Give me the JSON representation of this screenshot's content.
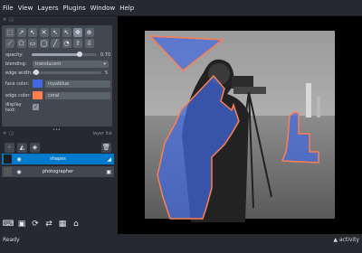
{
  "menu": [
    {
      "label": "File",
      "key": "F"
    },
    {
      "label": "View",
      "key": "V"
    },
    {
      "label": "Layers",
      "key": "L"
    },
    {
      "label": "Plugins",
      "key": "P"
    },
    {
      "label": "Window",
      "key": "W"
    },
    {
      "label": "Help",
      "key": "H"
    }
  ],
  "layer_controls": {
    "tools": [
      {
        "icon": "vertex-insert-icon",
        "glyph": "⬚"
      },
      {
        "icon": "vertex-remove-icon",
        "glyph": "↗"
      },
      {
        "icon": "select-vertices-icon",
        "glyph": "↖"
      },
      {
        "icon": "delete-shape-icon",
        "glyph": "✕"
      },
      {
        "icon": "select-shapes-icon",
        "glyph": "↖"
      },
      {
        "icon": "direct-select-icon",
        "glyph": "↖"
      },
      {
        "icon": "pan-zoom-icon",
        "glyph": "✥"
      },
      {
        "icon": "transform-icon",
        "glyph": "⊕"
      },
      {
        "icon": "path-icon",
        "glyph": "⟋"
      },
      {
        "icon": "polygon-icon",
        "glyph": "⬠"
      },
      {
        "icon": "rectangle-icon",
        "glyph": "▭"
      },
      {
        "icon": "ellipse-icon",
        "glyph": "◯"
      },
      {
        "icon": "line-icon",
        "glyph": "╱"
      },
      {
        "icon": "lasso-icon",
        "glyph": "◔"
      },
      {
        "icon": "move-front-icon",
        "glyph": "⇧"
      },
      {
        "icon": "move-back-icon",
        "glyph": "⇩"
      }
    ],
    "opacity_label": "opacity:",
    "opacity_value": "0.70",
    "opacity_fraction": 0.7,
    "blending_label": "blending:",
    "blending_value": "translucent",
    "edge_width_label": "edge width:",
    "edge_width_value": "5",
    "edge_width_fraction": 0.05,
    "face_color_label": "face color:",
    "face_color_value": "royalblue",
    "face_color_hex": "#4169e1",
    "edge_color_label": "edge color:",
    "edge_color_value": "coral",
    "edge_color_hex": "#ff7f50",
    "display_text_label": "display text:",
    "display_text_checked": true
  },
  "layers_title": "layer list",
  "layers": [
    {
      "name": "shapes",
      "selected": true,
      "type_icon": "shapes-layer-icon"
    },
    {
      "name": "photographer",
      "selected": false,
      "type_icon": "image-layer-icon"
    }
  ],
  "status": {
    "left": "Ready",
    "right": "activity"
  }
}
